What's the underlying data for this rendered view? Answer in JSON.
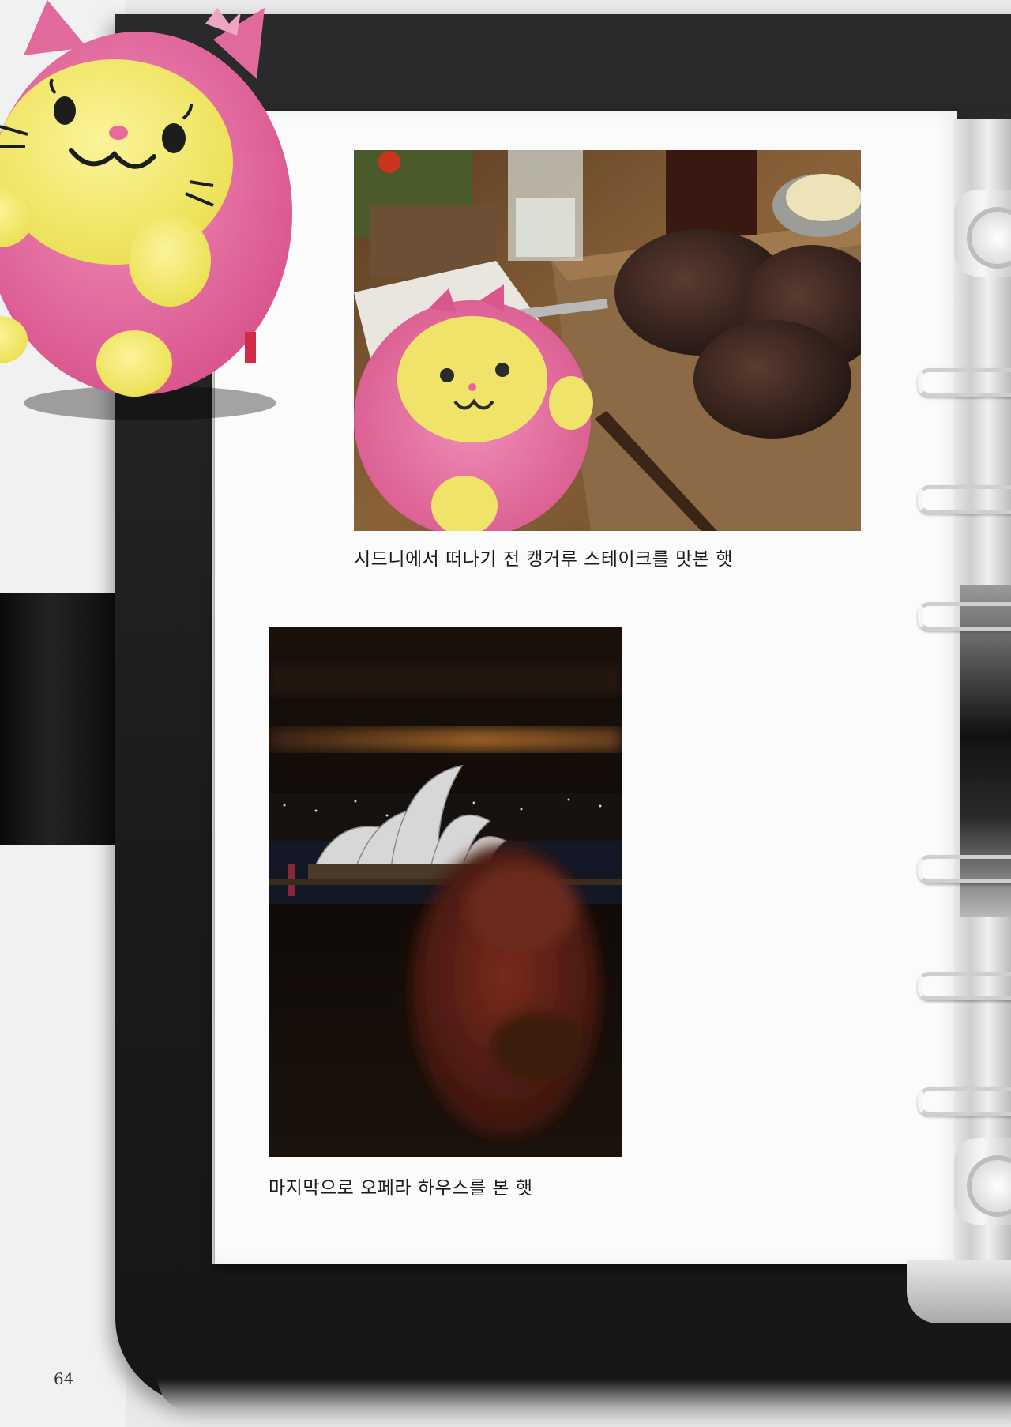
{
  "page": {
    "number": "64"
  },
  "entries": [
    {
      "caption": "시드니에서 떠나기 전 캥거루 스테이크를 맛본 햇"
    },
    {
      "caption": "마지막으로 오페라 하우스를 본 햇"
    }
  ],
  "colors": {
    "board": "#1d1d1e",
    "page": "#fbfbfb",
    "plush_pink": "#e8609a",
    "plush_yellow": "#f3ee6a",
    "caption_text": "#1b1b1b"
  },
  "icons": [
    "plush-toy",
    "binder-rings"
  ]
}
